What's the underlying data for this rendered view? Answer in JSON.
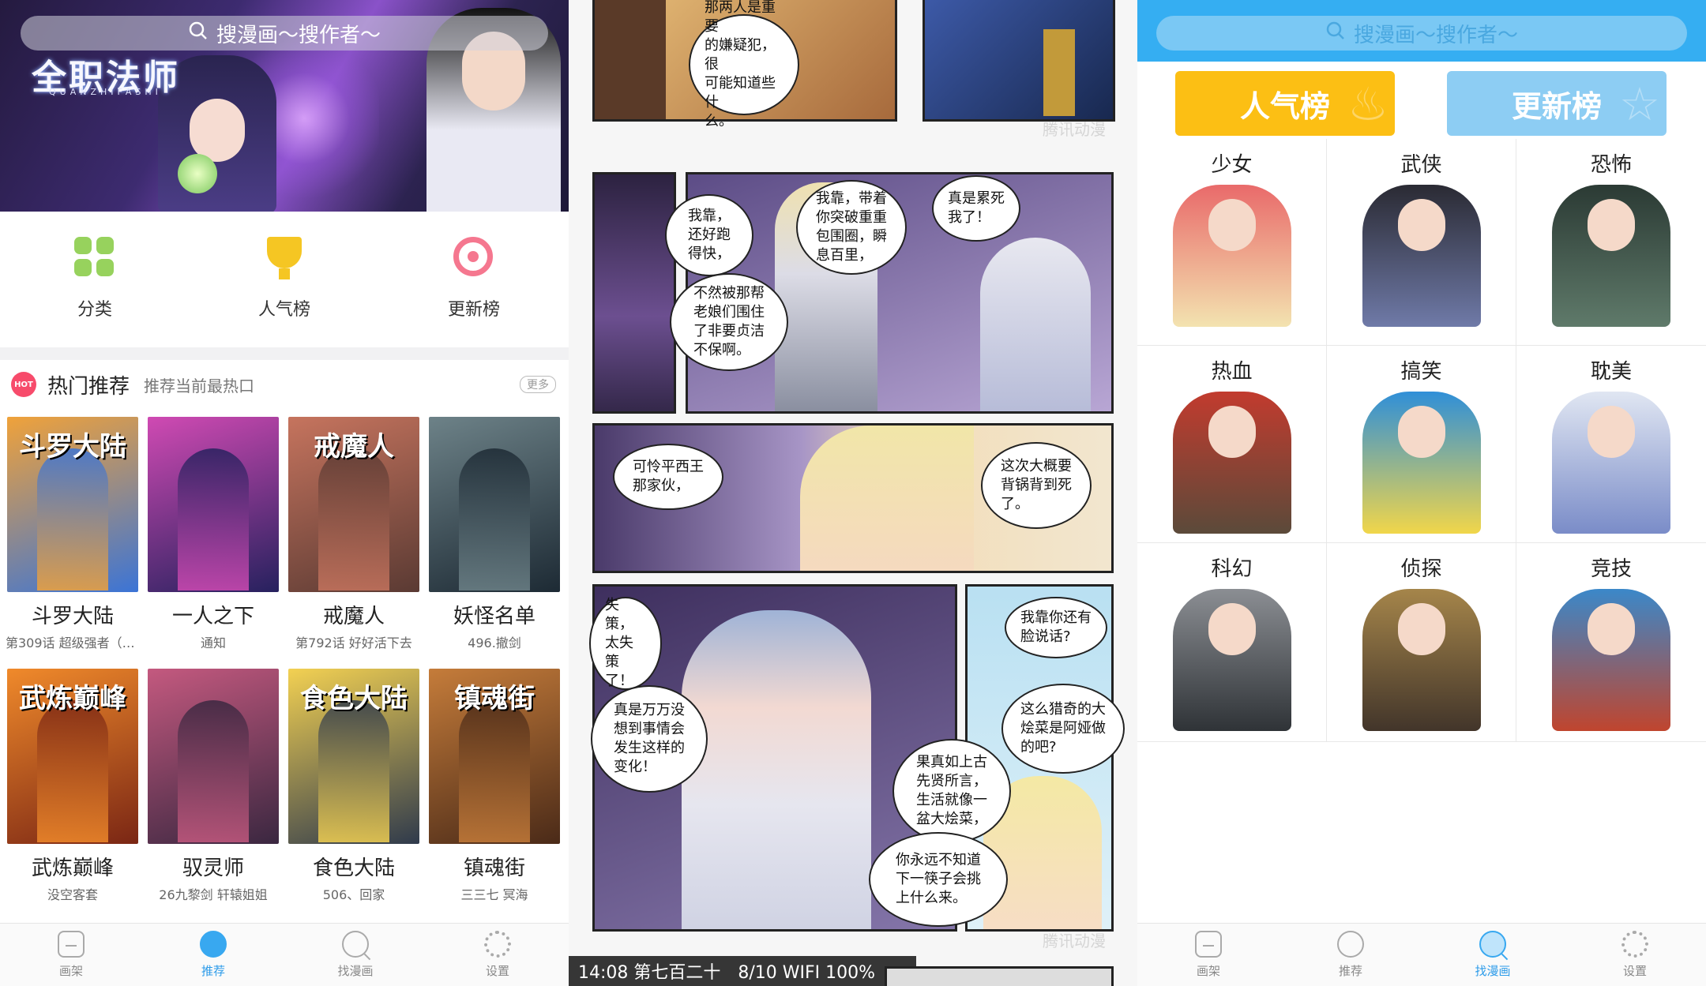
{
  "home": {
    "search_placeholder": "搜漫画～搜作者～",
    "banner": {
      "logo": "全职法师",
      "logo_sub": "QUANZHIFASHI"
    },
    "quick": [
      {
        "label": "分类",
        "icon": "grid-icon"
      },
      {
        "label": "人气榜",
        "icon": "trophy-icon"
      },
      {
        "label": "更新榜",
        "icon": "target-icon"
      }
    ],
    "hot": {
      "badge": "HOT",
      "title": "热门推荐",
      "subtitle": "推荐当前最热口",
      "more": "更多"
    },
    "comics": [
      {
        "name": "斗罗大陆",
        "sub": "第309话 超级强者（2...",
        "cover_title": "斗罗大陆",
        "c1": "#f0a23a",
        "c2": "#3b74d6"
      },
      {
        "name": "一人之下",
        "sub": "通知",
        "cover_title": "",
        "c1": "#d04ab3",
        "c2": "#26215e"
      },
      {
        "name": "戒魔人",
        "sub": "第792话 好好活下去",
        "cover_title": "戒魔人",
        "c1": "#c6745e",
        "c2": "#5a3a33"
      },
      {
        "name": "妖怪名单",
        "sub": "496.撤剑",
        "cover_title": "",
        "c1": "#6d8288",
        "c2": "#1d2a34"
      },
      {
        "name": "武炼巅峰",
        "sub": "没空客套",
        "cover_title": "武炼巅峰",
        "c1": "#f08a2b",
        "c2": "#7a2614"
      },
      {
        "name": "驭灵师",
        "sub": "26九黎剑 轩辕姐姐",
        "cover_title": "",
        "c1": "#c4597f",
        "c2": "#3a2740"
      },
      {
        "name": "食色大陆",
        "sub": "506、回家",
        "cover_title": "食色大陆",
        "c1": "#f3d152",
        "c2": "#2f3a4c"
      },
      {
        "name": "镇魂街",
        "sub": "三三七 冥海",
        "cover_title": "镇魂街",
        "c1": "#c57c3a",
        "c2": "#4a2a18"
      }
    ],
    "tabs": [
      {
        "label": "画架",
        "icon": "shelf-icon",
        "active": false
      },
      {
        "label": "推荐",
        "icon": "recommend-icon",
        "active": true
      },
      {
        "label": "找漫画",
        "icon": "find-icon",
        "active": false
      },
      {
        "label": "设置",
        "icon": "settings-icon",
        "active": false
      }
    ]
  },
  "reader": {
    "bubbles": [
      "那两人是重要\n的嫌疑犯，很\n可能知道些什\n么。",
      "我靠，\n还好跑\n得快，",
      "我靠，带着\n你突破重重\n包围圈，瞬\n息百里，",
      "真是累死\n我了！",
      "不然被那帮\n老娘们围住\n了非要贞洁\n不保啊。",
      "可怜平西王\n那家伙，",
      "这次大概要\n背锅背到死\n了。",
      "失策，\n太失策\n了！",
      "真是万万没\n想到事情会\n发生这样的\n变化！",
      "我靠你还有\n脸说话?",
      "这么猎奇的大\n烩菜是阿娅做\n的吧?",
      "果真如上古\n先贤所言，\n生活就像一\n盆大烩菜，",
      "你永远不知道\n下一筷子会挑\n上什么来。"
    ],
    "watermark": "腾讯动漫",
    "status_bar": "14:08 第七百二十　8/10 WIFI 100%"
  },
  "find": {
    "search_placeholder": "搜漫画～搜作者～",
    "rank_popular": "人气榜",
    "rank_update": "更新榜",
    "categories": [
      {
        "label": "少女",
        "c1": "#e96a6a",
        "c2": "#f3e3b0"
      },
      {
        "label": "武侠",
        "c1": "#2a2a33",
        "c2": "#6f7aa8"
      },
      {
        "label": "恐怖",
        "c1": "#2b3a34",
        "c2": "#5f7a6a"
      },
      {
        "label": "热血",
        "c1": "#c23b2e",
        "c2": "#5b4a3a"
      },
      {
        "label": "搞笑",
        "c1": "#2f8fd8",
        "c2": "#f1d64a"
      },
      {
        "label": "耽美",
        "c1": "#e0e6f2",
        "c2": "#7a8cc8"
      },
      {
        "label": "科幻",
        "c1": "#8b8e93",
        "c2": "#2f3337"
      },
      {
        "label": "侦探",
        "c1": "#a5854a",
        "c2": "#42352a"
      },
      {
        "label": "竞技",
        "c1": "#3b88c9",
        "c2": "#c0452e"
      }
    ],
    "tabs": [
      {
        "label": "画架",
        "icon": "shelf-icon",
        "active": false
      },
      {
        "label": "推荐",
        "icon": "recommend-icon",
        "active": false
      },
      {
        "label": "找漫画",
        "icon": "find-icon",
        "active": true
      },
      {
        "label": "设置",
        "icon": "settings-icon",
        "active": false
      }
    ]
  }
}
